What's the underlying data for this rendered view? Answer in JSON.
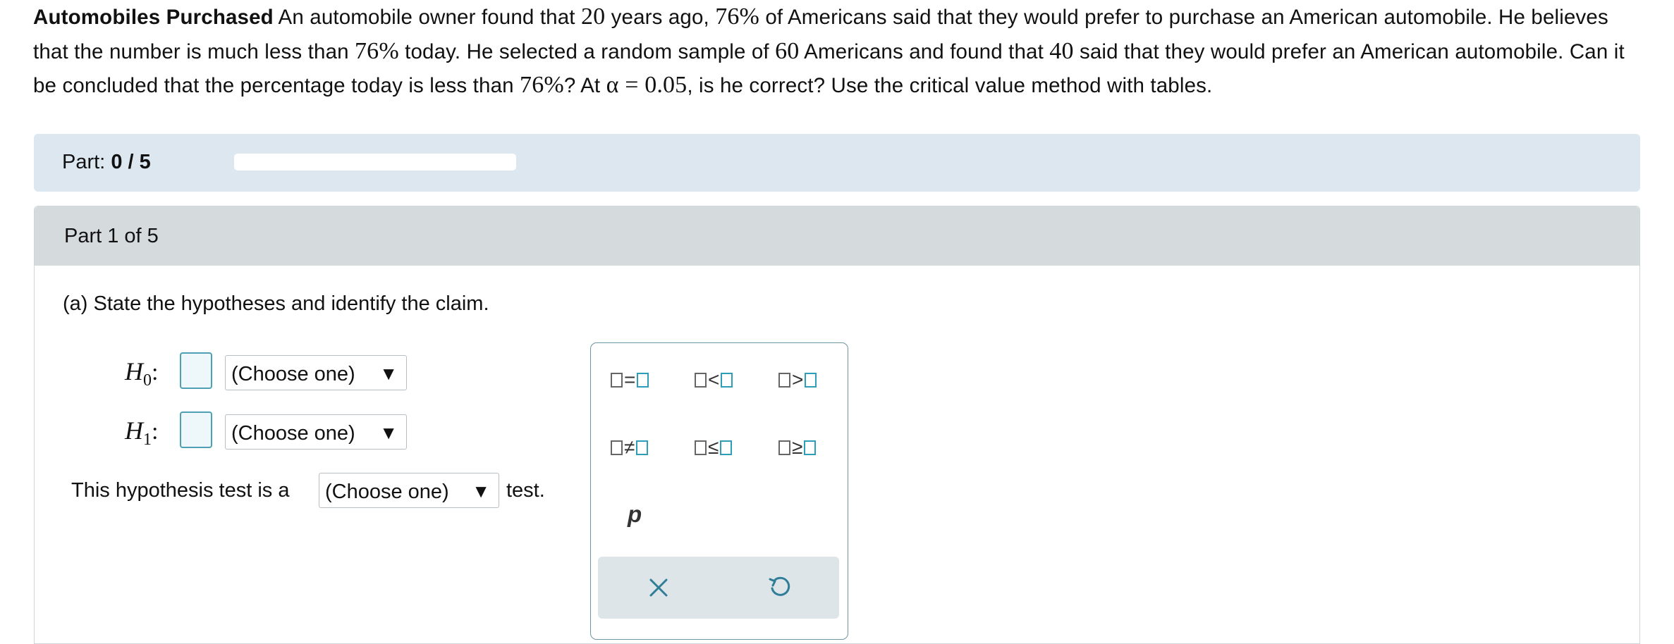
{
  "problem": {
    "heading": "Automobiles Purchased",
    "t1": " An automobile owner found that ",
    "n_years": "20",
    "t2": " years ago, ",
    "pct1": "76%",
    "t3": " of Americans said that they would prefer to purchase an American automobile. He believes that the number is much less than ",
    "pct2": "76%",
    "t4": " today. He selected a random sample of ",
    "sample": "60",
    "t5": " Americans and found that ",
    "count": "40",
    "t6": " said that they would prefer an American automobile. Can it be concluded that the percentage today is less than ",
    "pct3": "76%",
    "t7": "? At ",
    "alpha_eq": "α = 0.05",
    "t8": ", is he correct? Use the critical value method with tables."
  },
  "progress": {
    "label": "Part: ",
    "value": "0 / 5",
    "fraction": 0
  },
  "part": {
    "title": "Part 1 of 5"
  },
  "question": {
    "text": "(a) State the hypotheses and identify the claim."
  },
  "hypotheses": {
    "h0_label": "H",
    "h0_sub": "0",
    "h1_label": "H",
    "h1_sub": "1",
    "colon": ":",
    "h0_select": "(Choose one)",
    "h1_select": "(Choose one)"
  },
  "test_sentence": {
    "before": "This hypothesis test is a",
    "select": "(Choose one)",
    "after": "test."
  },
  "palette": {
    "ops": [
      "=",
      "<",
      ">",
      "≠",
      "≤",
      "≥"
    ],
    "variable": "p",
    "clear_icon": "close-icon",
    "undo_icon": "undo-icon"
  },
  "dropdown_arrow": "▼",
  "colors": {
    "accent": "#2e9db7",
    "partbar": "#dce7ef",
    "header": "#d5dadd"
  }
}
